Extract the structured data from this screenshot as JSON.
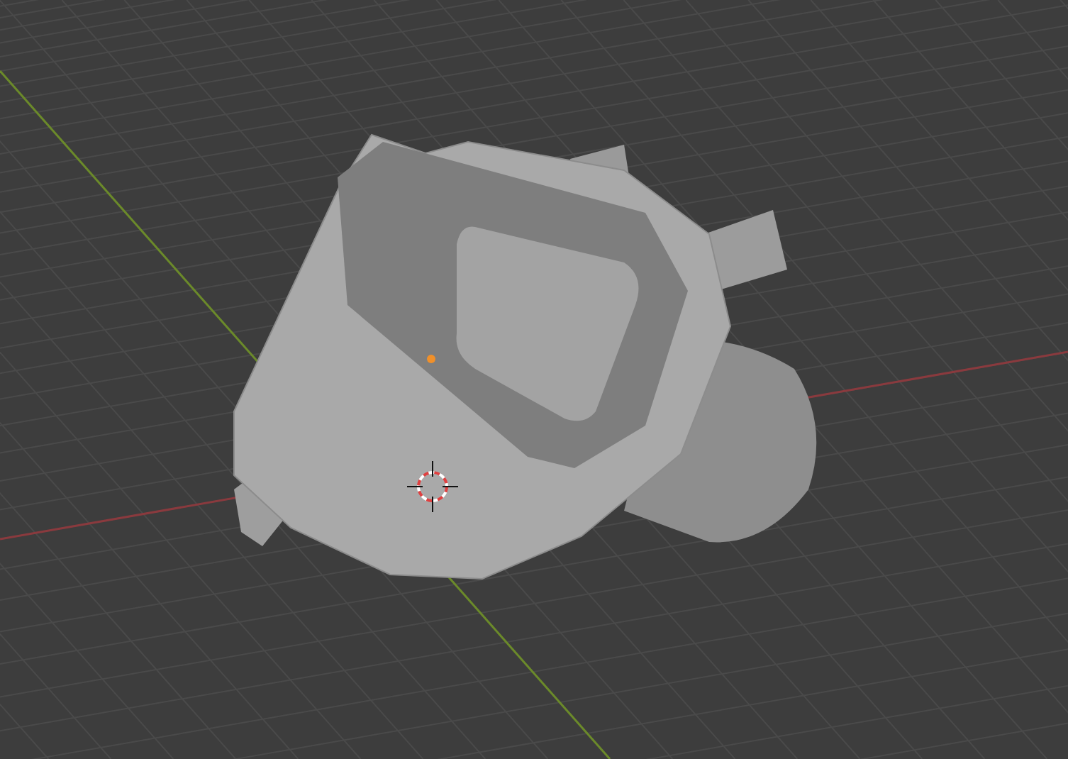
{
  "viewport": {
    "kind": "perspective",
    "origin_marker": true,
    "cursor_3d": true
  }
}
